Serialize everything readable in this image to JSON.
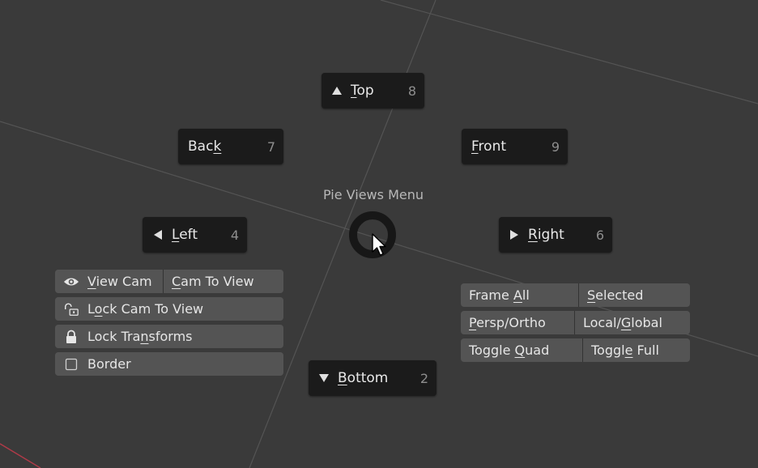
{
  "pie": {
    "title": "Pie Views Menu",
    "top": {
      "pre": "",
      "ul": "T",
      "post": "op",
      "key": "8"
    },
    "back": {
      "pre": "Bac",
      "ul": "k",
      "post": "",
      "key": "7"
    },
    "front": {
      "pre": "",
      "ul": "F",
      "post": "ront",
      "key": "9"
    },
    "left": {
      "pre": "",
      "ul": "L",
      "post": "eft",
      "key": "4"
    },
    "right": {
      "pre": "",
      "ul": "R",
      "post": "ight",
      "key": "6"
    },
    "bottom": {
      "pre": "",
      "ul": "B",
      "post": "ottom",
      "key": "2"
    }
  },
  "left_panel": {
    "view_cam": {
      "pre": "",
      "ul": "V",
      "post": "iew Cam"
    },
    "cam_to_view": {
      "pre": "",
      "ul": "C",
      "post": "am To View"
    },
    "lock_cam_to_view": {
      "pre": "L",
      "ul": "o",
      "post": "ck Cam To View"
    },
    "lock_transforms": {
      "pre": "Lock Tra",
      "ul": "n",
      "post": "sforms"
    },
    "border": {
      "label": "Border"
    }
  },
  "right_panel": {
    "frame_all": {
      "pre": "Frame ",
      "ul": "A",
      "post": "ll"
    },
    "selected": {
      "pre": "",
      "ul": "S",
      "post": "elected"
    },
    "persp_ortho": {
      "pre": "",
      "ul": "P",
      "post": "ersp/Ortho"
    },
    "local_global": {
      "pre": "Local/",
      "ul": "G",
      "post": "lobal"
    },
    "toggle_quad": {
      "pre": "Toggle ",
      "ul": "Q",
      "post": "uad"
    },
    "toggle_full": {
      "pre": "Toggl",
      "ul": "e",
      "post": " Full"
    }
  },
  "colors": {
    "background": "#3a3a3a",
    "pie_button": "#1b1b1b",
    "panel_button": "#545454",
    "grid_line": "#5a5a5a",
    "axis_x": "#b03a48"
  },
  "icons": [
    "triangle-up-icon",
    "triangle-left-icon",
    "triangle-right-icon",
    "triangle-down-icon",
    "eye-icon",
    "unlocked-icon",
    "lock-icon",
    "checkbox-icon",
    "mouse-cursor-icon"
  ]
}
